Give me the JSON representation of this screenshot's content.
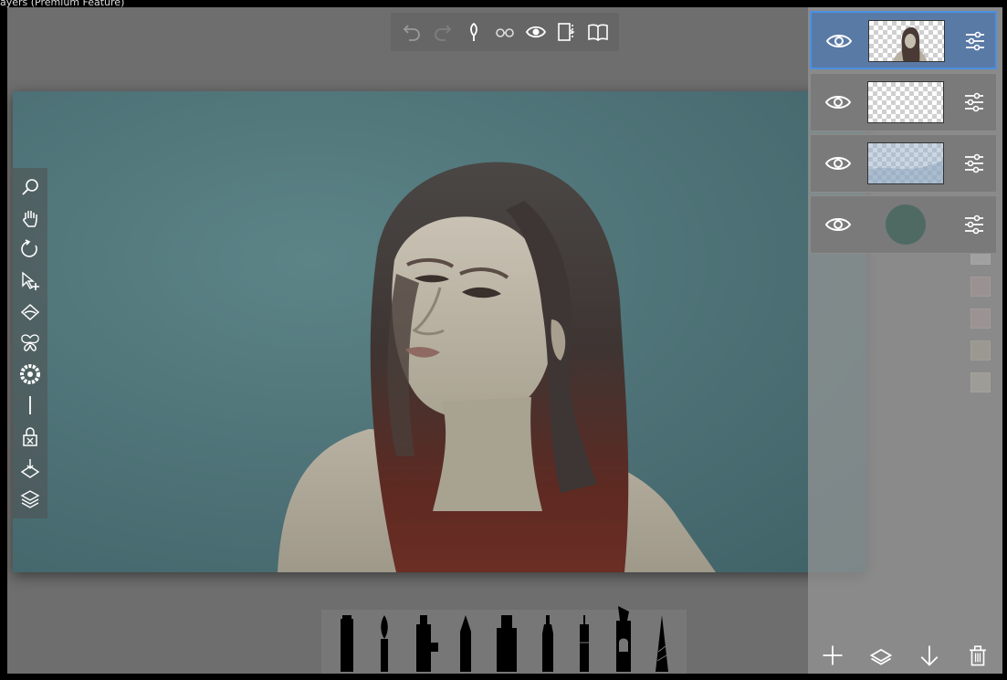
{
  "window": {
    "title": "ayers (Premium Feature)"
  },
  "top_toolbar": {
    "buttons": [
      {
        "icon": "undo-icon"
      },
      {
        "icon": "redo-icon"
      },
      {
        "icon": "pen-nib-icon"
      },
      {
        "icon": "glasses-icon"
      },
      {
        "icon": "eye-icon"
      },
      {
        "icon": "reference-panel-icon"
      },
      {
        "icon": "book-icon"
      }
    ]
  },
  "left_toolbar": {
    "tools": [
      {
        "icon": "magnifier-icon"
      },
      {
        "icon": "hand-icon"
      },
      {
        "icon": "rotate-icon"
      },
      {
        "icon": "select-move-icon"
      },
      {
        "icon": "fill-bucket-icon"
      },
      {
        "icon": "butterfly-symmetry-icon"
      },
      {
        "icon": "color-wheel-icon"
      },
      {
        "icon": "line-icon"
      },
      {
        "icon": "lock-layer-icon"
      },
      {
        "icon": "merge-down-icon"
      },
      {
        "icon": "layers-icon"
      }
    ]
  },
  "layers": [
    {
      "id": "layer-1",
      "visible": true,
      "selected": true,
      "thumbnail": "portrait"
    },
    {
      "id": "layer-2",
      "visible": true,
      "selected": false,
      "thumbnail": "transparent"
    },
    {
      "id": "layer-3",
      "visible": true,
      "selected": false,
      "thumbnail": "light-blue-wash"
    },
    {
      "id": "layer-4",
      "visible": true,
      "selected": false,
      "thumbnail": "background-color",
      "color": "#4f6a63"
    }
  ],
  "layer_actions": [
    {
      "icon": "add-layer-icon"
    },
    {
      "icon": "duplicate-layer-icon"
    },
    {
      "icon": "move-down-icon"
    },
    {
      "icon": "trash-icon"
    }
  ],
  "palette": {
    "swatches": [
      "#bdbdbd",
      "#a58a84",
      "#a88b87",
      "#a99c85",
      "#b2ae96"
    ]
  },
  "brushes": [
    {
      "name": "marker"
    },
    {
      "name": "round-brush"
    },
    {
      "name": "airbrush"
    },
    {
      "name": "pencil"
    },
    {
      "name": "thick-marker"
    },
    {
      "name": "fine-liner"
    },
    {
      "name": "technical-pen"
    },
    {
      "name": "ink-pen"
    },
    {
      "name": "sharp-pencil"
    }
  ],
  "colors": {
    "accent": "#4a90e2",
    "selected_layer_bg": "#5a7aa6",
    "canvas_bg": "#4c7075",
    "app_bg": "#6e6e6e"
  }
}
